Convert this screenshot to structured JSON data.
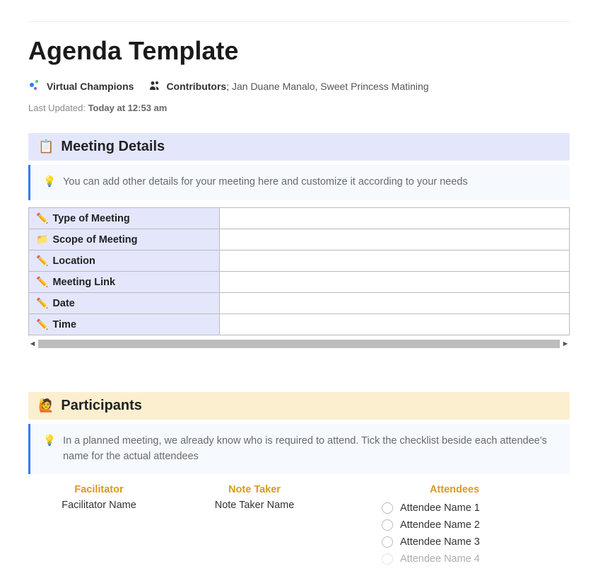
{
  "title": "Agenda Template",
  "workspace": "Virtual Champions",
  "contributors_label": "Contributors",
  "contributors": "Jan Duane Manalo, Sweet Princess Matining",
  "last_updated_label": "Last Updated:",
  "last_updated_value": "Today at 12:53 am",
  "sections": {
    "meeting_details": {
      "title": "Meeting Details",
      "icon": "📋",
      "tip": "You can add other details for your meeting here and customize it according to your needs",
      "rows": [
        {
          "icon": "✏️",
          "icon_class": "pencil",
          "label": "Type of Meeting",
          "value": ""
        },
        {
          "icon": "📁",
          "icon_class": "",
          "label": "Scope of Meeting",
          "value": ""
        },
        {
          "icon": "✏️",
          "icon_class": "pencil",
          "label": "Location",
          "value": ""
        },
        {
          "icon": "✏️",
          "icon_class": "pencil",
          "label": "Meeting Link",
          "value": ""
        },
        {
          "icon": "✏️",
          "icon_class": "pencil",
          "label": "Date",
          "value": ""
        },
        {
          "icon": "✏️",
          "icon_class": "pencil",
          "label": "Time",
          "value": ""
        }
      ]
    },
    "participants": {
      "title": "Participants",
      "icon": "🙋",
      "tip": "In a planned meeting, we already know who is required to attend. Tick the checklist beside each attendee's name for the actual attendees",
      "facilitator_header": "Facilitator",
      "facilitator_value": "Facilitator Name",
      "note_taker_header": "Note Taker",
      "note_taker_value": "Note Taker Name",
      "attendees_header": "Attendees",
      "attendees": [
        {
          "name": "Attendee Name 1",
          "checked": false
        },
        {
          "name": "Attendee Name 2",
          "checked": false
        },
        {
          "name": "Attendee Name 3",
          "checked": false
        },
        {
          "name": "Attendee Name 4",
          "checked": false
        }
      ]
    }
  }
}
